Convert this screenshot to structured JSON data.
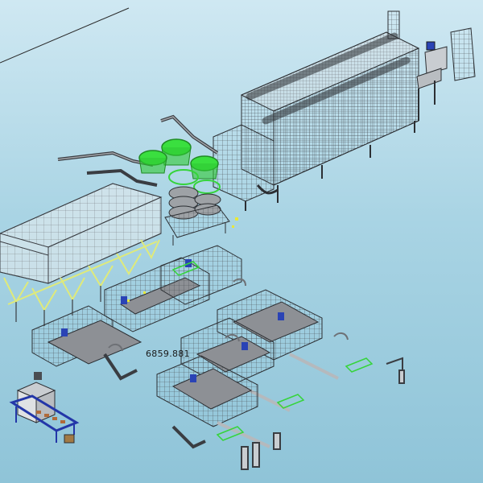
{
  "viewport": {
    "dimension_label": "6859.881",
    "colors": {
      "background_top": "#cfe8f2",
      "background_bottom": "#8fc4d8",
      "machine_line": "#3a3d42",
      "green_tanks": "#35d43a",
      "yellow_supports": "#e6f08a",
      "blue_frame": "#2336a8",
      "conveyor_belt": "#6d6f73"
    }
  }
}
